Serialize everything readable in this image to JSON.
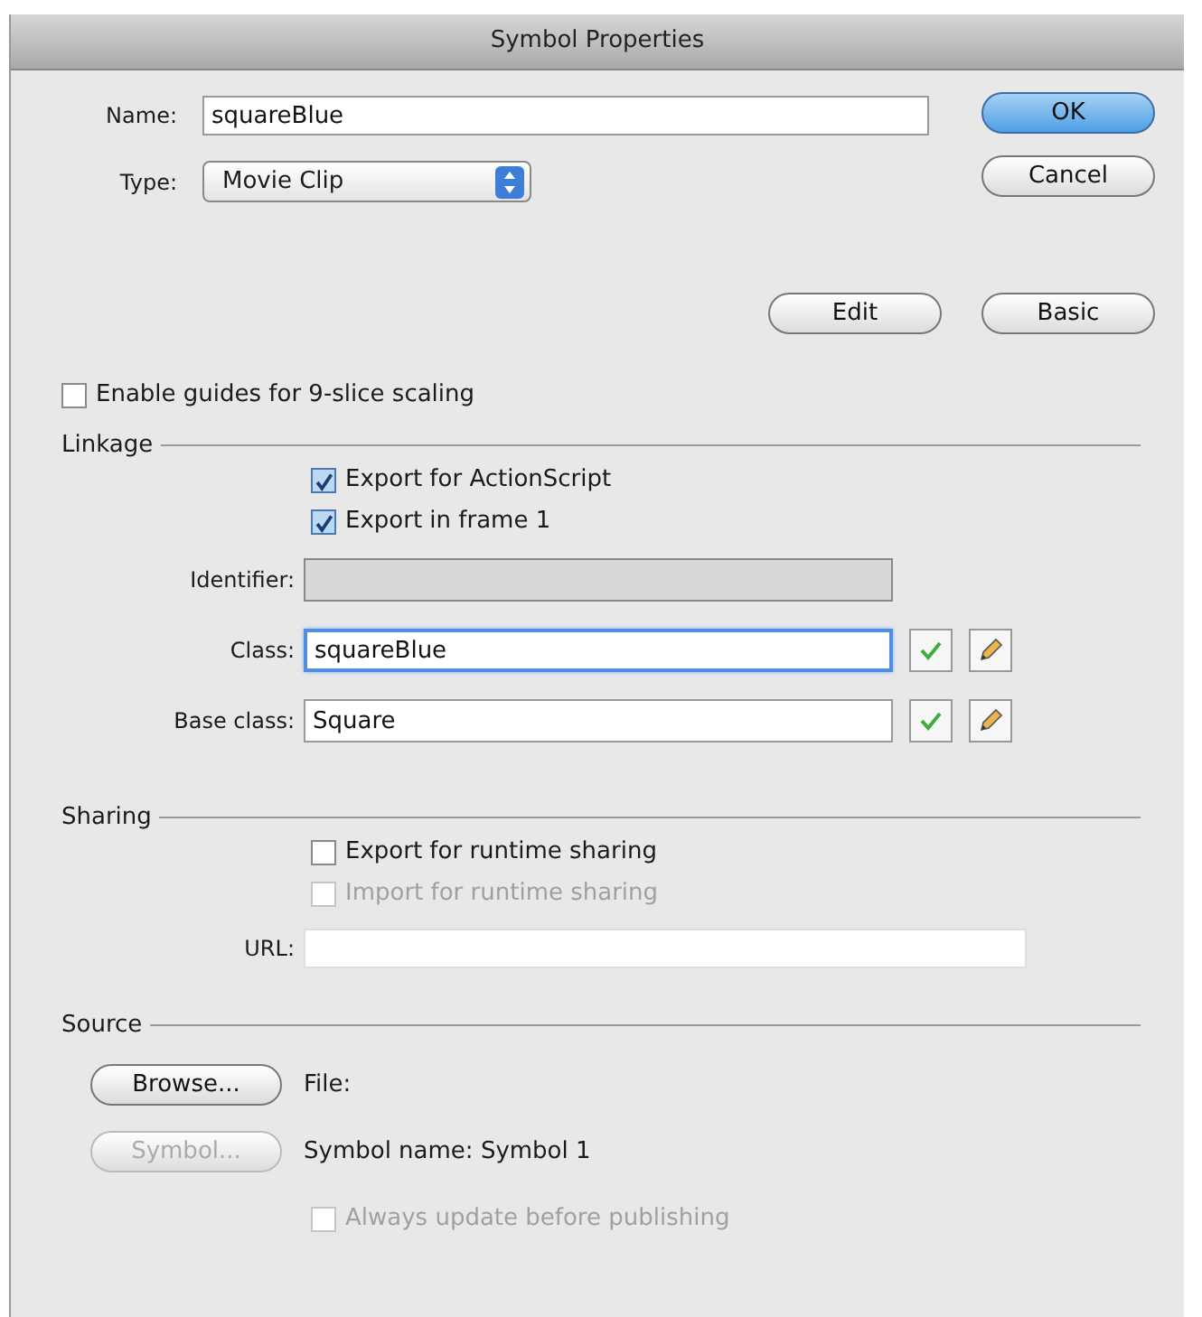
{
  "window": {
    "title": "Symbol Properties"
  },
  "name": {
    "label": "Name:",
    "value": "squareBlue"
  },
  "type": {
    "label": "Type:",
    "value": "Movie Clip"
  },
  "buttons": [
    {
      "label": "OK",
      "kind": "default"
    },
    {
      "label": "Cancel",
      "kind": "normal"
    }
  ],
  "mode_buttons": [
    {
      "label": "Edit"
    },
    {
      "label": "Basic"
    }
  ],
  "nine_slice": {
    "label": "Enable guides for 9-slice scaling",
    "checked": false
  },
  "linkage": {
    "title": "Linkage",
    "checkboxes": [
      {
        "label": "Export for ActionScript",
        "checked": true,
        "disabled": false
      },
      {
        "label": "Export in frame 1",
        "checked": true,
        "disabled": false
      }
    ],
    "fields": [
      {
        "label": "Identifier:",
        "disabled": true,
        "focused": false,
        "kind": "plain"
      },
      {
        "label": "Class:",
        "value": "squareBlue",
        "disabled": false,
        "focused": true,
        "kind": "tools"
      },
      {
        "label": "Base class:",
        "value": "Square",
        "disabled": false,
        "focused": false,
        "kind": "tools"
      }
    ]
  },
  "sharing": {
    "title": "Sharing",
    "checkboxes": [
      {
        "label": "Export for runtime sharing",
        "checked": false,
        "disabled": false
      },
      {
        "label": "Import for runtime sharing",
        "checked": false,
        "disabled": true
      }
    ],
    "url": {
      "label": "URL:"
    }
  },
  "source": {
    "title": "Source",
    "rows": [
      {
        "button": "Browse...",
        "disabled": false,
        "text": "File:"
      },
      {
        "button": "Symbol...",
        "disabled": true,
        "text": "Symbol name: Symbol 1"
      }
    ],
    "always_update": {
      "label": "Always update before publishing",
      "checked": false,
      "disabled": true
    }
  }
}
